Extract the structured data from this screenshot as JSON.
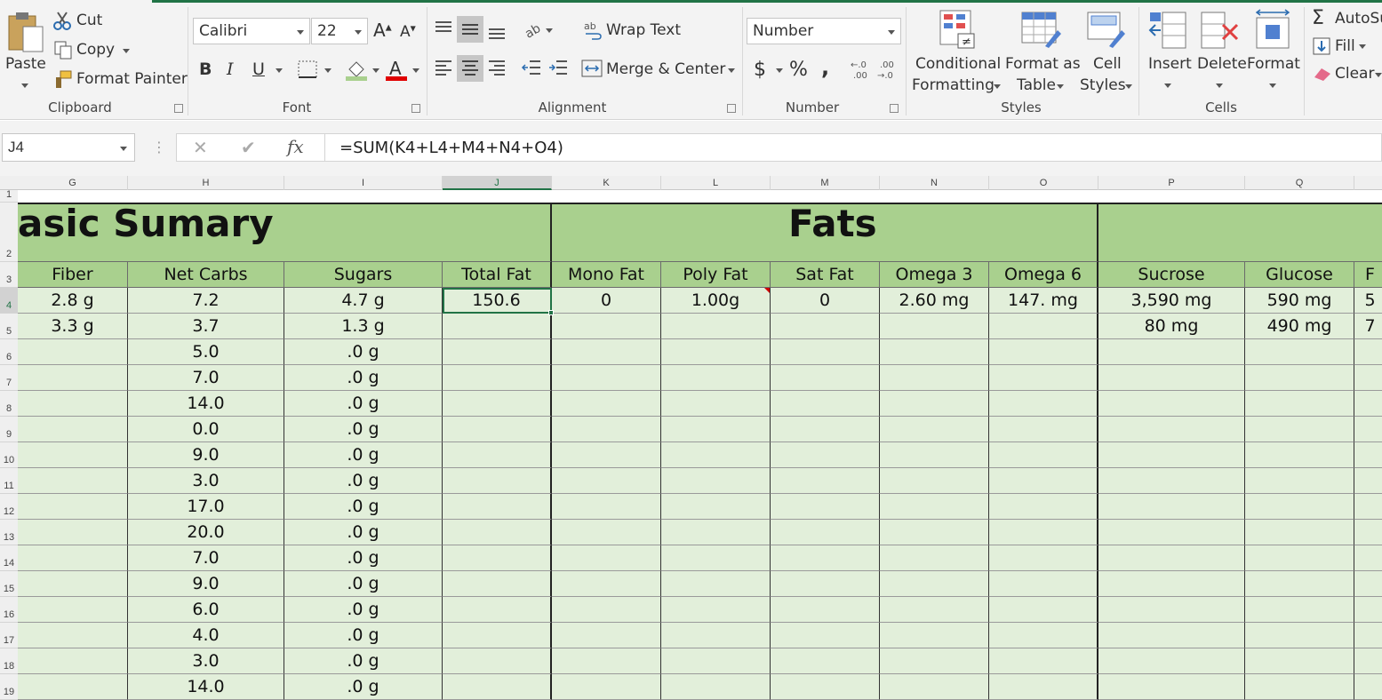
{
  "ribbon": {
    "clipboard": {
      "paste": "Paste",
      "cut": "Cut",
      "copy": "Copy",
      "format_painter": "Format Painter",
      "label": "Clipboard"
    },
    "font": {
      "name": "Calibri",
      "size": "22",
      "bold": "B",
      "italic": "I",
      "underline": "U",
      "label": "Font",
      "fill_color": "#ffff00",
      "font_color": "#ff0000"
    },
    "alignment": {
      "wrap_text": "Wrap Text",
      "merge_center": "Merge & Center",
      "label": "Alignment"
    },
    "number": {
      "format": "Number",
      "currency": "$",
      "percent": "%",
      "comma": ",",
      "label": "Number"
    },
    "styles": {
      "conditional": "Conditional",
      "formatting": "Formatting",
      "format_as": "Format as",
      "table": "Table",
      "cell": "Cell",
      "styles": "Styles",
      "label": "Styles"
    },
    "cells": {
      "insert": "Insert",
      "delete": "Delete",
      "format": "Format",
      "label": "Cells"
    },
    "editing": {
      "autosum": "AutoSu",
      "fill": "Fill",
      "clear": "Clear"
    }
  },
  "formula_bar": {
    "name_box": "J4",
    "formula": "=SUM(K4+L4+M4+N4+O4)",
    "fx": "fx"
  },
  "grid": {
    "columns": [
      "G",
      "H",
      "I",
      "J",
      "K",
      "L",
      "M",
      "N",
      "O",
      "P",
      "Q"
    ],
    "row_numbers": [
      "1",
      "2",
      "3",
      "4",
      "5",
      "6",
      "7",
      "8",
      "9",
      "10",
      "11",
      "12",
      "13",
      "14",
      "15",
      "16",
      "17",
      "18",
      "19"
    ],
    "section_basic": "asic Sumary",
    "section_fats": "Fats",
    "headers": [
      "Fiber",
      "Net Carbs",
      "Sugars",
      "Total Fat",
      "Mono Fat",
      "Poly Fat",
      "Sat Fat",
      "Omega 3",
      "Omega 6",
      "Sucrose",
      "Glucose",
      "F"
    ],
    "row4": [
      "2.8 g",
      "7.2",
      "4.7 g",
      "150.6",
      "0",
      "1.00g",
      "0",
      "2.60 mg",
      "147. mg",
      "3,590 mg",
      "590 mg",
      "5"
    ],
    "row5": [
      "3.3 g",
      "3.7",
      "1.3 g",
      "",
      "",
      "",
      "",
      "",
      "",
      "80 mg",
      "490 mg",
      "7"
    ],
    "net_carbs": [
      "5.0",
      "7.0",
      "14.0",
      "0.0",
      "9.0",
      "3.0",
      "17.0",
      "20.0",
      "7.0",
      "9.0",
      "6.0",
      "4.0",
      "3.0",
      "14.0"
    ],
    "sugars": [
      ".0 g",
      ".0 g",
      ".0 g",
      ".0 g",
      ".0 g",
      ".0 g",
      ".0 g",
      ".0 g",
      ".0 g",
      ".0 g",
      ".0 g",
      ".0 g",
      ".0 g",
      ".0 g"
    ]
  }
}
